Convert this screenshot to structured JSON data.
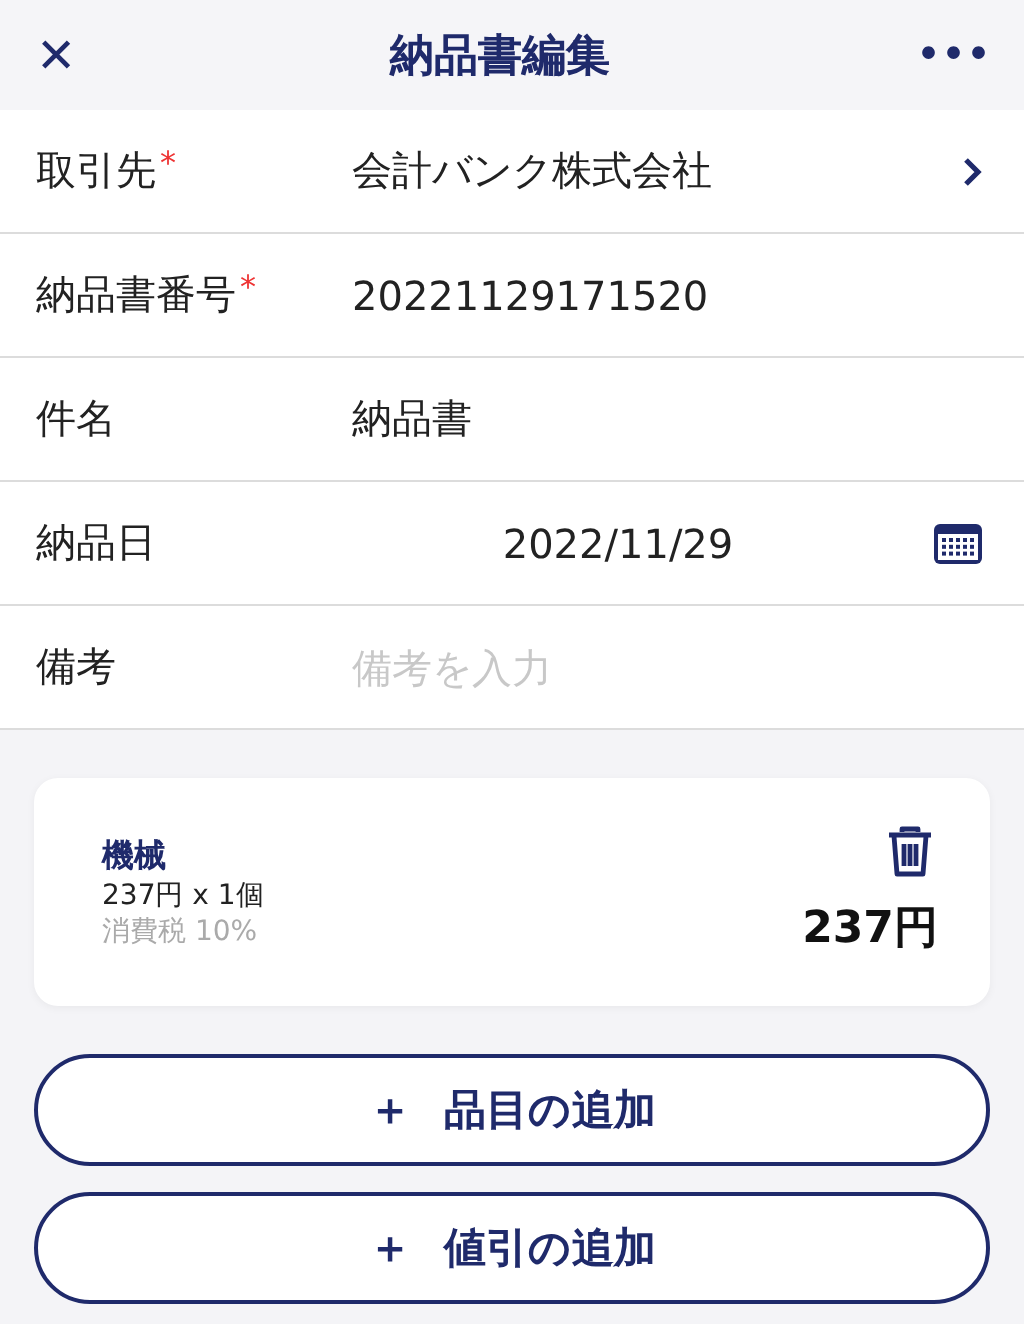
{
  "header": {
    "close": "✕",
    "title": "納品書編集",
    "more": "•••"
  },
  "fields": [
    {
      "kind": "link",
      "label": "取引先",
      "required_mark": "*",
      "value": "会計バンク株式会社"
    },
    {
      "kind": "text",
      "label": "納品書番号",
      "required_mark": "*",
      "value": "20221129171520"
    },
    {
      "kind": "text",
      "label": "件名",
      "value": "納品書"
    },
    {
      "kind": "date",
      "label": "納品日",
      "value": "2022/11/29"
    },
    {
      "kind": "input",
      "label": "備考",
      "placeholder": "備考を入力"
    }
  ],
  "items": [
    {
      "name": "機械",
      "quantity": "237円 x 1個",
      "tax": "消費税 10%",
      "amount": "237円"
    }
  ],
  "actions": [
    {
      "icon": "＋",
      "label": "品目の追加"
    },
    {
      "icon": "＋",
      "label": "値引の追加"
    }
  ]
}
